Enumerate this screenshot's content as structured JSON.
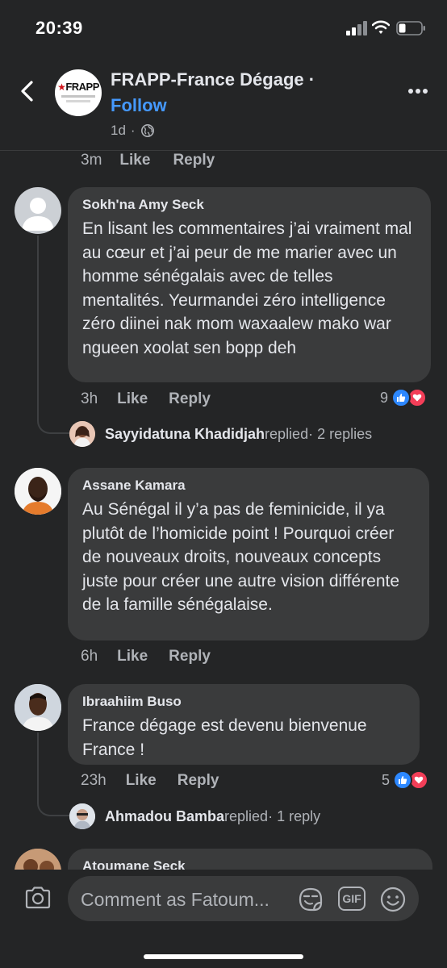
{
  "status_bar": {
    "time": "20:39"
  },
  "header": {
    "page_name": "FRAPP-France Dégage ·",
    "page_logo_text": "FRAPP",
    "follow_label": "Follow",
    "post_age": "1d",
    "separator": "·",
    "privacy_icon": "globe-icon"
  },
  "previous_comment_actions": {
    "time": "3m",
    "like": "Like",
    "reply": "Reply"
  },
  "comments": [
    {
      "author": "Sokh'na Amy Seck",
      "text": "En lisant les commentaires j’ai vraiment mal au cœur et j’ai peur de me marier avec un homme sénégalais avec de telles mentalités. Yeurmandei zéro intelligence zéro diinei nak mom waxaalew mako war ngueen xoolat sen bopp deh",
      "time": "3h",
      "like": "Like",
      "reply": "Reply",
      "reaction_count": "9",
      "reply_summary": {
        "name": "Sayyidatuna Khadidjah",
        "replied": " replied",
        "count": " · 2 replies"
      }
    },
    {
      "author": "Assane Kamara",
      "text": "Au Sénégal il y’a pas de feminicide, il ya plutôt de l’homicide point ! Pourquoi créer de nouveaux droits, nouveaux concepts juste pour créer une autre vision différente de la famille sénégalaise.",
      "time": "6h",
      "like": "Like",
      "reply": "Reply"
    },
    {
      "author": "Ibraahiim Buso",
      "text": "France dégage est devenu bienvenue France !",
      "time": "23h",
      "like": "Like",
      "reply": "Reply",
      "reaction_count": "5",
      "reply_summary": {
        "name": "Ahmadou Bamba",
        "replied": " replied",
        "count": " · 1 reply"
      }
    },
    {
      "author": "Atoumane Seck"
    }
  ],
  "composer": {
    "placeholder": "Comment as Fatoum...",
    "gif_label": "GIF"
  },
  "colors": {
    "background": "#242526",
    "bubble": "#3a3b3c",
    "link": "#4599ff",
    "like": "#2d88ff",
    "love": "#f33e58"
  }
}
